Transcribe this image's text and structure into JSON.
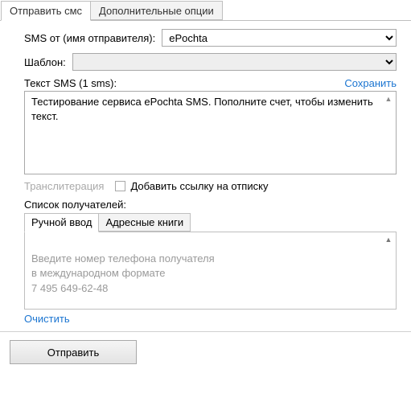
{
  "tabs": {
    "send": "Отправить смс",
    "options": "Дополнительные опции"
  },
  "sender": {
    "label": "SMS от (имя отправителя):",
    "value": "ePochta"
  },
  "template": {
    "label": "Шаблон:"
  },
  "sms": {
    "label": "Текст SMS (1 sms):",
    "save": "Сохранить",
    "text": "Тестирование сервиса ePochta SMS. Пополните счет, чтобы изменить текст."
  },
  "translit": {
    "label": "Транслитерация",
    "unsubscribe": "Добавить ссылку на отписку"
  },
  "recipients": {
    "label": "Список получателей:",
    "tab_manual": "Ручной ввод",
    "tab_books": "Адресные книги",
    "placeholder": "Введите номер телефона получателя\nв международном формате\n7 495 649-62-48",
    "clear": "Очистить"
  },
  "actions": {
    "send": "Отправить"
  }
}
